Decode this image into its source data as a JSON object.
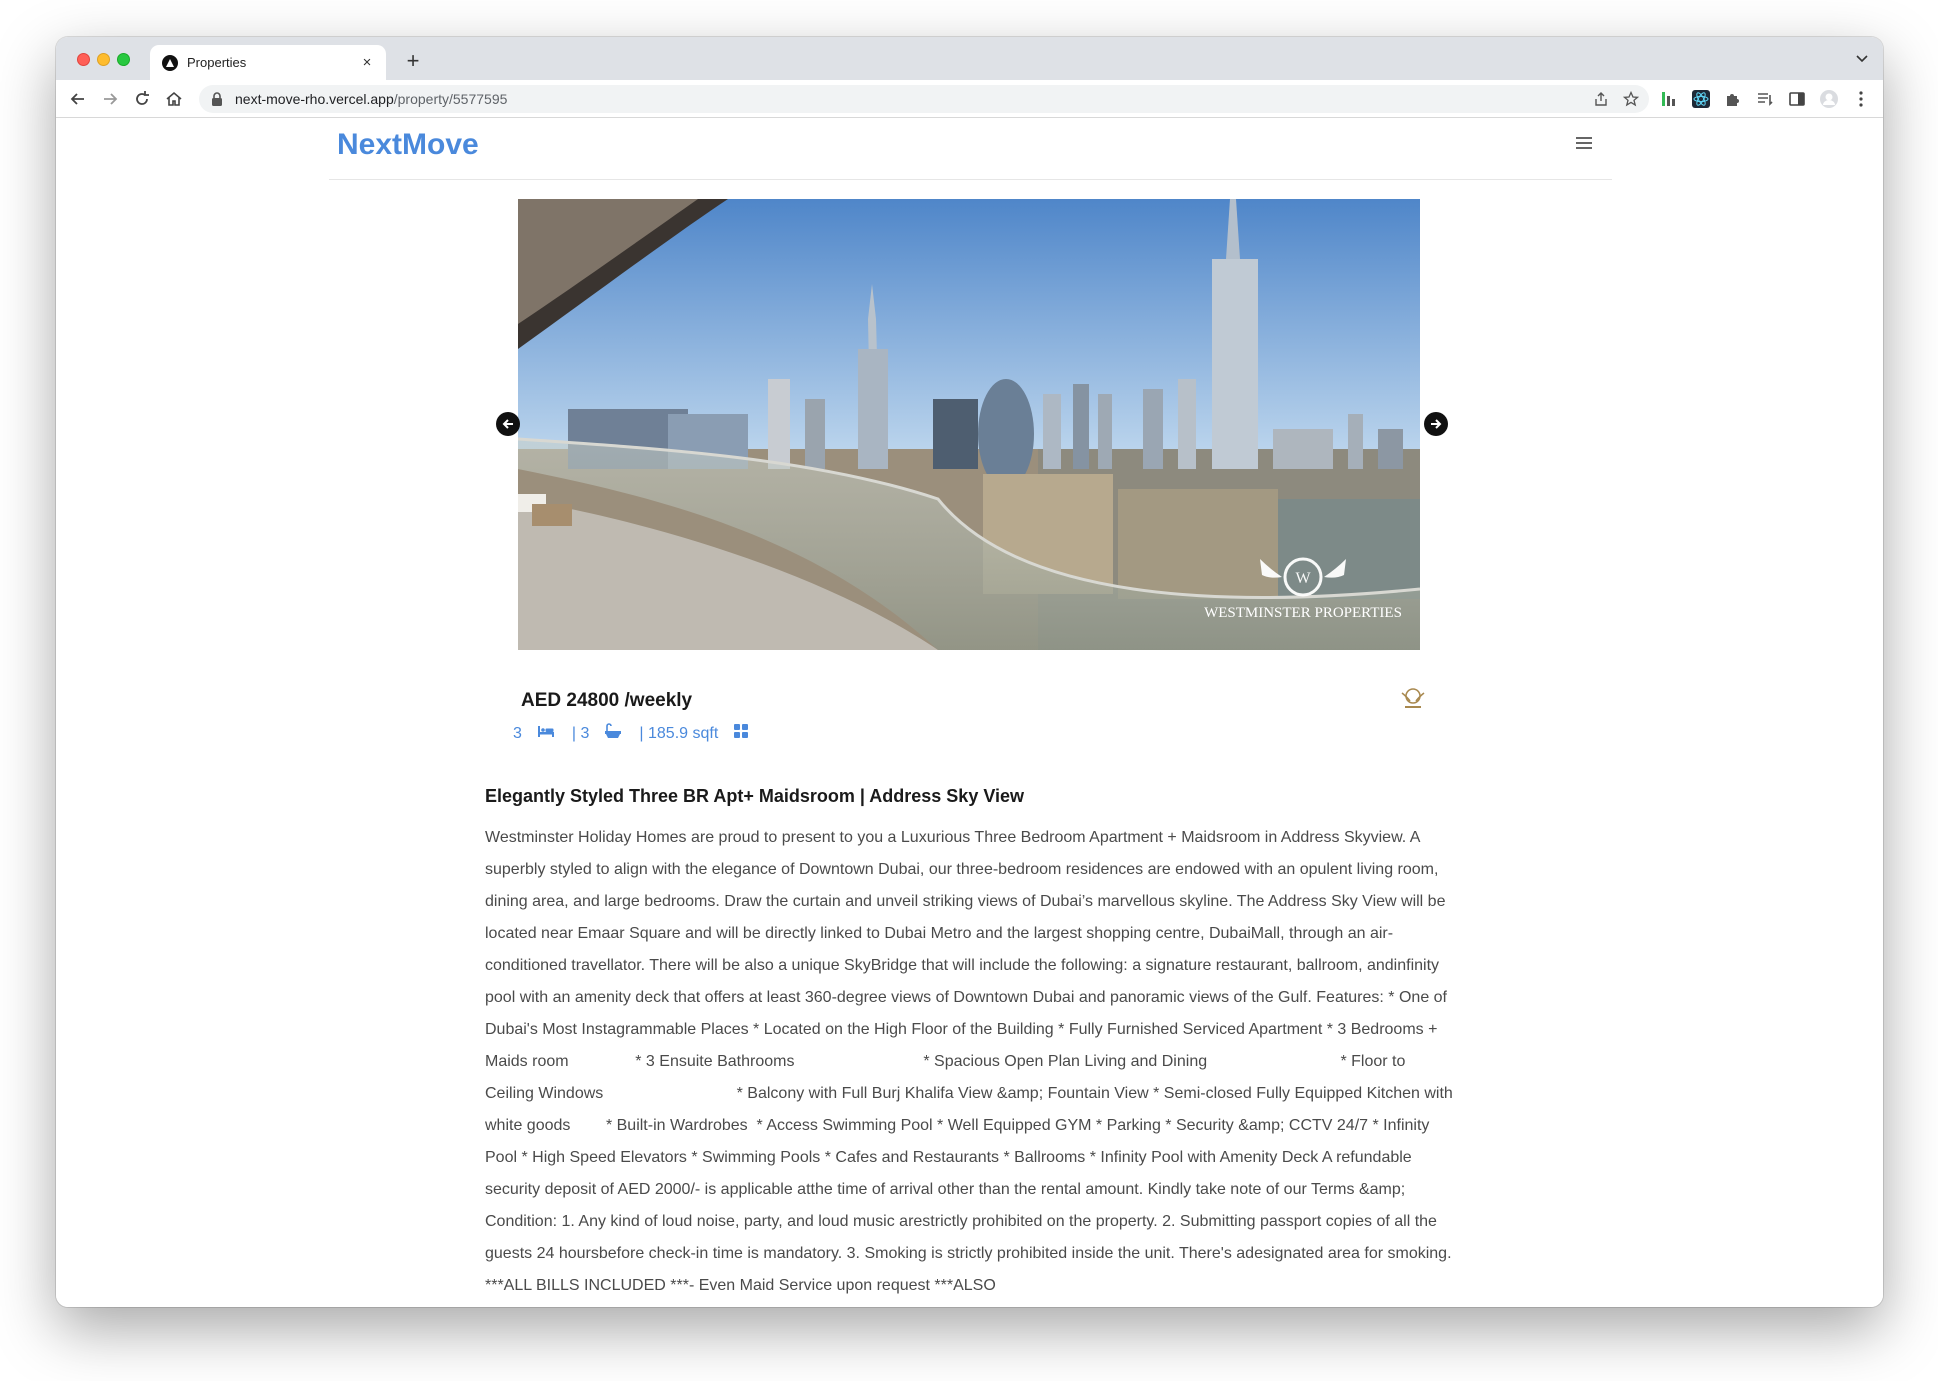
{
  "browser": {
    "tab_title": "Properties",
    "new_tab_label": "+",
    "close_tab_label": "×",
    "url_host": "next-move-rho.vercel.app",
    "url_path": "/property/5577595"
  },
  "site": {
    "brand": "NextMove",
    "menu_icon": "hamburger-menu-icon"
  },
  "listing": {
    "image_watermark": "WESTMINSTER PROPERTIES",
    "price": "AED 24800 /weekly",
    "bedrooms": "3",
    "bathrooms": "| 3",
    "area": "| 185.9 sqft",
    "title": "Elegantly Styled Three BR Apt+ Maidsroom | Address Sky View",
    "description": "Westminster Holiday Homes are proud to present to you a Luxurious Three Bedroom Apartment + Maidsroom in Address Skyview. A superbly styled to align with the elegance of Downtown Dubai, our three-bedroom residences are endowed with an opulent living room, dining area, and large bedrooms. Draw the curtain and unveil striking views of Dubai’s marvellous skyline. The Address Sky View will be located near Emaar Square and will be directly linked to Dubai Metro and the largest shopping centre, DubaiMall, through an air-conditioned travellator. There will be also a unique SkyBridge that will include the following: a signature restaurant, ballroom, andinfinity pool with an amenity deck that offers at least 360-degree views of Downtown Dubai and panoramic views of the Gulf. Features: * One of Dubai's Most Instagrammable Places * Located on the High Floor of the Building * Fully Furnished Serviced Apartment * 3 Bedrooms + Maids room               * 3 Ensuite Bathrooms                             * Spacious Open Plan Living and Dining                              * Floor to Ceiling Windows                              * Balcony with Full Burj Khalifa View &amp; Fountain View * Semi-closed Fully Equipped Kitchen with white goods        * Built-in Wardrobes  * Access Swimming Pool * Well Equipped GYM * Parking * Security &amp; CCTV 24/7 * Infinity Pool * High Speed Elevators * Swimming Pools * Cafes and Restaurants * Ballrooms * Infinity Pool with Amenity Deck A refundable security deposit of AED 2000/- is applicable atthe time of arrival other than the rental amount. Kindly take note of our Terms &amp; Condition: 1. Any kind of loud noise, party, and loud music arestrictly prohibited on the property. 2. Submitting passport copies of all the guests 24 hoursbefore check-in time is mandatory. 3. Smoking is strictly prohibited inside the unit. There's adesignated area for smoking. ***ALL BILLS INCLUDED ***- Even Maid Service upon request ***ALSO"
  },
  "colors": {
    "brand": "#4a89dc",
    "text": "#4a4a4a",
    "heading": "#1a1a1a"
  }
}
